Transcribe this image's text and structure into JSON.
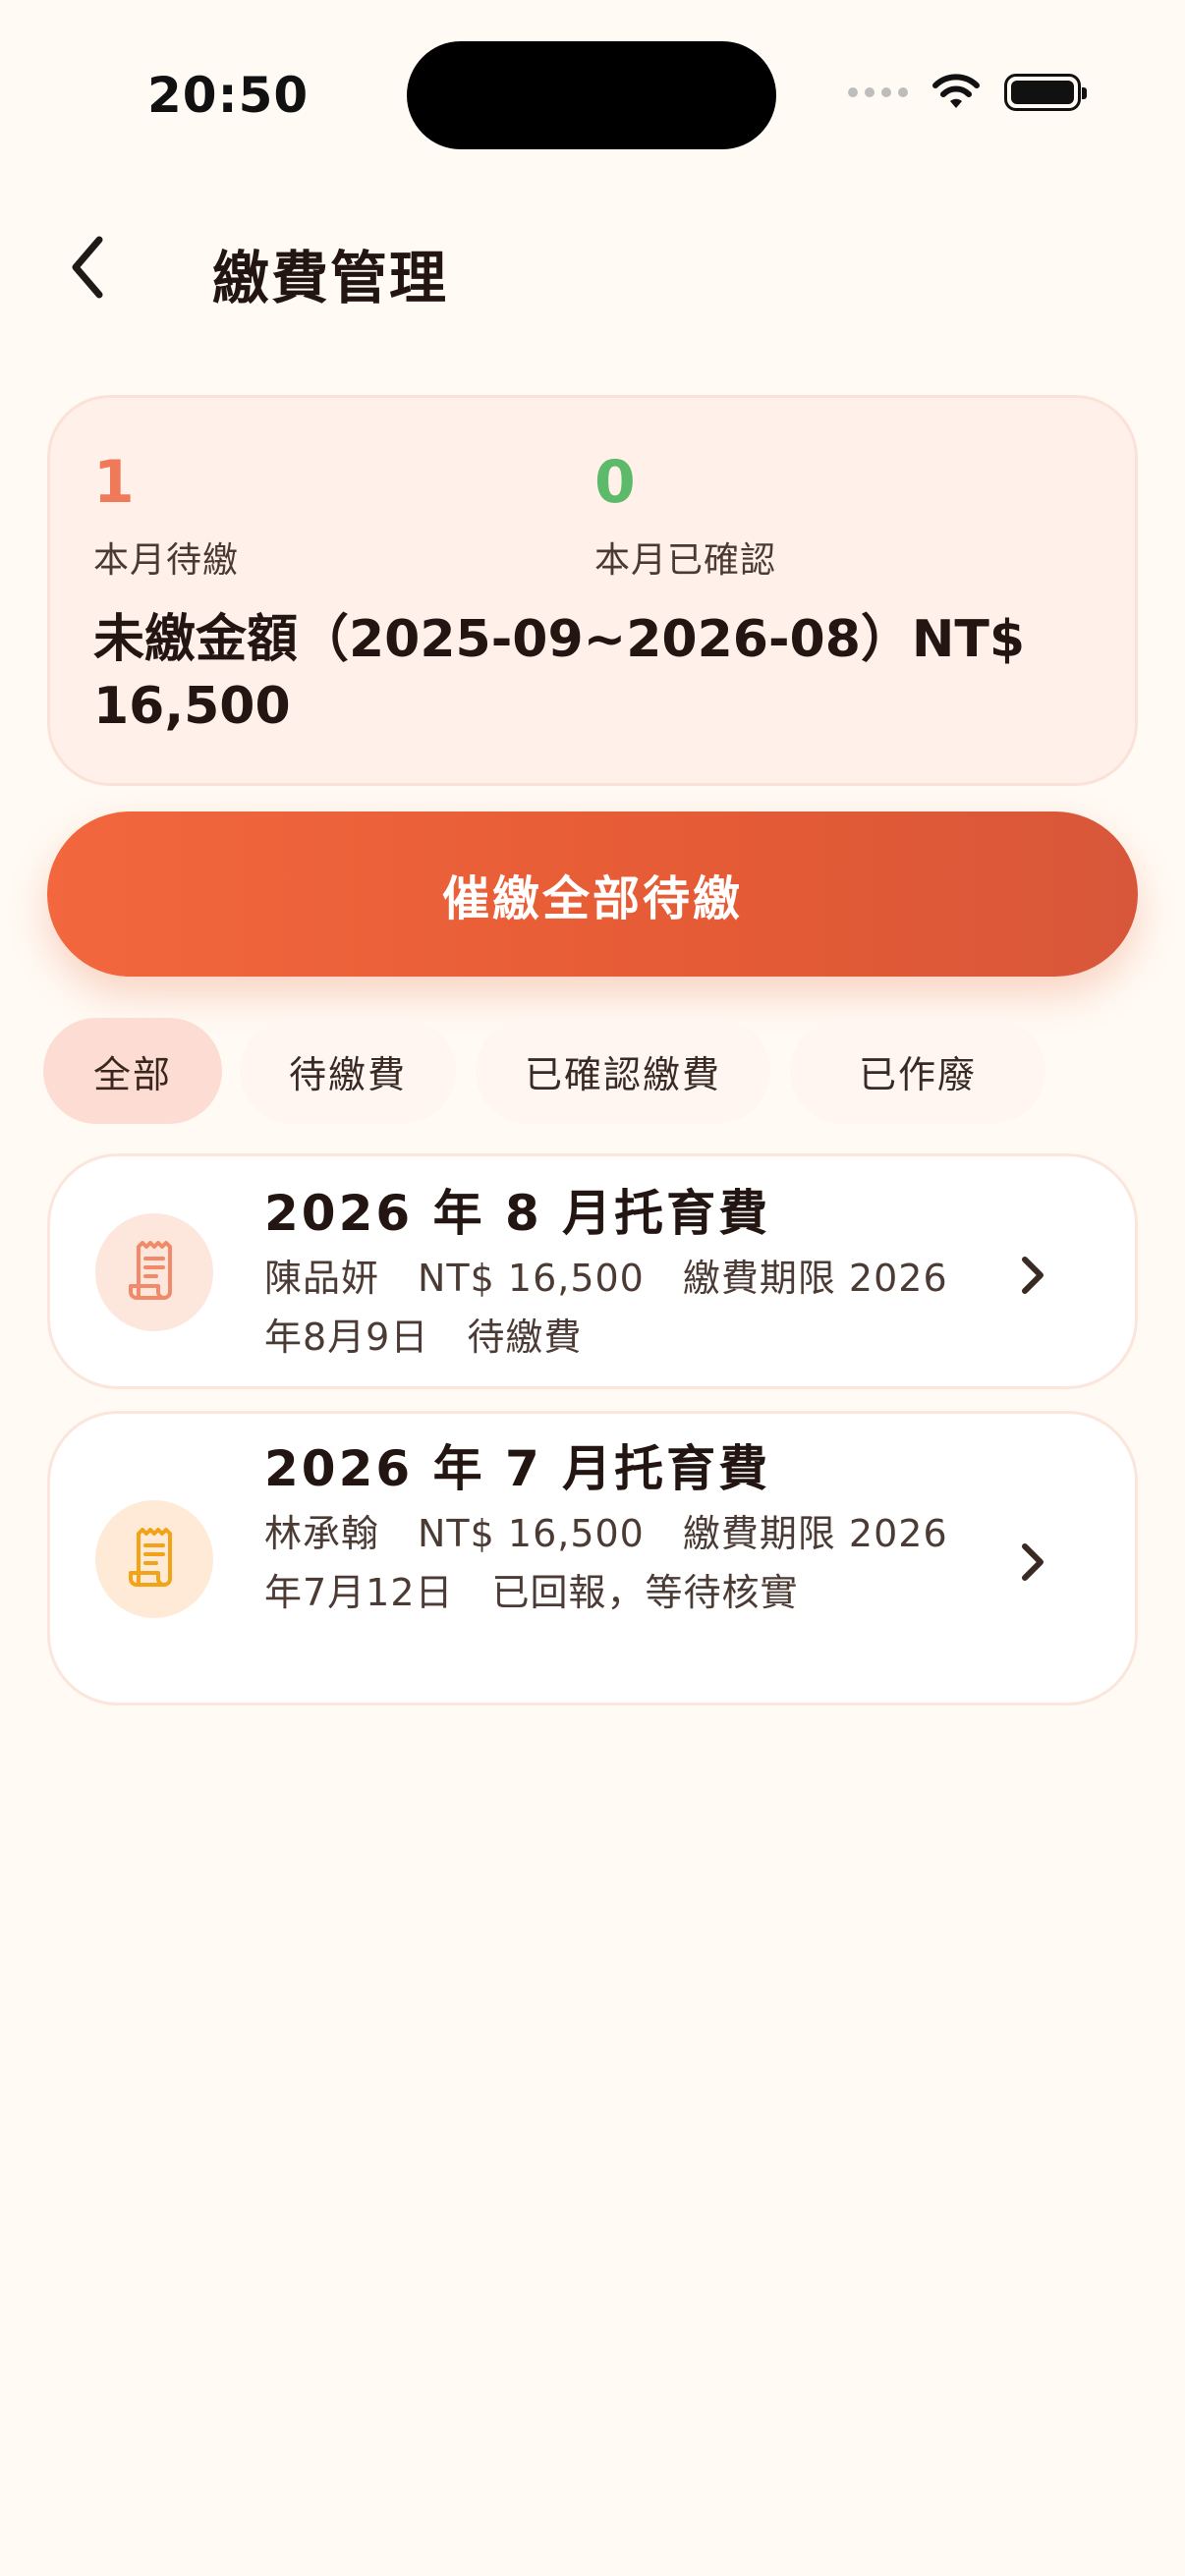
{
  "status_bar": {
    "time": "20:50"
  },
  "header": {
    "title": "繳費管理"
  },
  "summary": {
    "pending_count": "1",
    "pending_label": "本月待繳",
    "confirmed_count": "0",
    "confirmed_label": "本月已確認",
    "unpaid_amount": "未繳金額（2025-09~2026-08）NT$ 16,500"
  },
  "actions": {
    "remind_all_label": "催繳全部待繳"
  },
  "filter_tabs": [
    {
      "label": "全部",
      "active": true
    },
    {
      "label": "待繳費",
      "active": false
    },
    {
      "label": "已確認繳費",
      "active": false
    },
    {
      "label": "已作廢",
      "active": false
    }
  ],
  "payments": [
    {
      "title": "2026 年 8 月托育費",
      "detail": "陳品妍　NT$ 16,500　繳費期限 2026年8月9日　待繳費",
      "icon": "receipt-icon",
      "icon_color": "#F08A6A"
    },
    {
      "title": "2026 年 7 月托育費",
      "detail": "林承翰　NT$ 16,500　繳費期限 2026年7月12日　已回報，等待核實",
      "icon": "receipt-icon",
      "icon_color": "#F2A316"
    }
  ],
  "colors": {
    "accent": "#F0673E",
    "background": "#FFFAF4",
    "pending": "#F0795A",
    "confirmed": "#5DBA6A"
  }
}
